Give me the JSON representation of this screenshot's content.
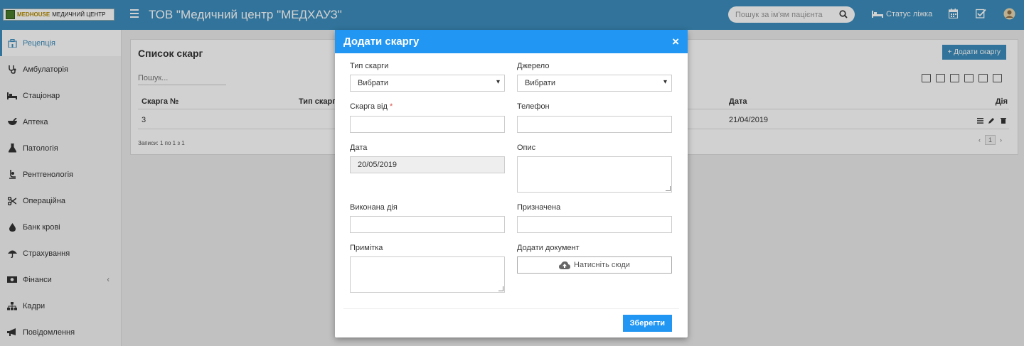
{
  "header": {
    "logo_brand": "MEDHOUSE",
    "logo_sub": "МЕДИЧНИЙ ЦЕНТР",
    "title": "ТОВ \"Медичний центр \"МЕДХАУЗ\"",
    "search_placeholder": "Пошук за ім'ям пацієнта",
    "bed_status": "Статус ліжка"
  },
  "sidebar": {
    "items": [
      {
        "label": "Рецепція",
        "icon": "hospital-icon"
      },
      {
        "label": "Амбулаторія",
        "icon": "stethoscope-icon"
      },
      {
        "label": "Стаціонар",
        "icon": "bed-icon"
      },
      {
        "label": "Аптека",
        "icon": "mortar-icon"
      },
      {
        "label": "Патологія",
        "icon": "flask-icon"
      },
      {
        "label": "Рентгенологія",
        "icon": "xray-icon"
      },
      {
        "label": "Операційна",
        "icon": "scissors-icon"
      },
      {
        "label": "Банк крові",
        "icon": "blood-drop-icon"
      },
      {
        "label": "Страхування",
        "icon": "umbrella-icon"
      },
      {
        "label": "Фінанси",
        "icon": "money-icon"
      },
      {
        "label": "Кадри",
        "icon": "sitemap-icon"
      },
      {
        "label": "Повідомлення",
        "icon": "bullhorn-icon"
      }
    ]
  },
  "main": {
    "title": "Список скарг",
    "add_button": "+ Додати скаргу",
    "search_placeholder": "Пошук...",
    "columns": [
      "Скарга №",
      "Тип скарг",
      "Дата",
      "Дія"
    ],
    "rows": [
      {
        "number": "3",
        "date": "21/04/2019"
      }
    ],
    "records": "Записи: 1 по 1 з 1",
    "page": "1"
  },
  "modal": {
    "title": "Додати скаргу",
    "close": "×",
    "type_label": "Тип скарги",
    "type_value": "Вибрати",
    "source_label": "Джерело",
    "source_value": "Вибрати",
    "from_label": "Скарга від",
    "required_mark": "*",
    "phone_label": "Телефон",
    "date_label": "Дата",
    "date_value": "20/05/2019",
    "description_label": "Опис",
    "action_label": "Виконана дія",
    "assigned_label": "Призначена",
    "note_label": "Примітка",
    "document_label": "Додати документ",
    "upload_label": "Натисніть сюди",
    "save_label": "Зберегти"
  },
  "colors": {
    "topbar": "#3c8dbc",
    "modal_header": "#2196f3",
    "accent": "#3c8dbc"
  }
}
